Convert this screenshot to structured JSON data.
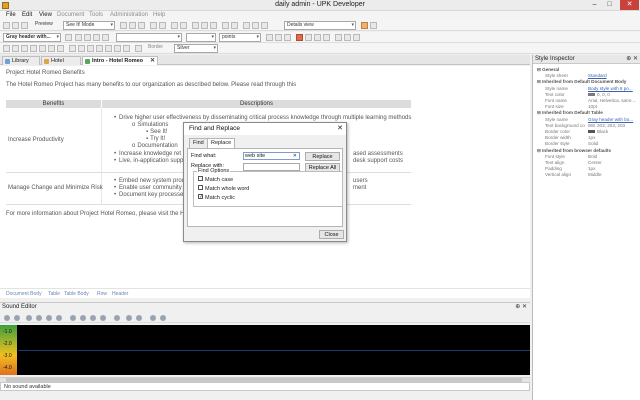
{
  "window": {
    "title": "daily admin - UPK Developer",
    "minimize": "–",
    "maximize": "□",
    "close": "✕"
  },
  "menu": [
    {
      "label": "File",
      "enabled": true
    },
    {
      "label": "Edit",
      "enabled": true
    },
    {
      "label": "View",
      "enabled": true
    },
    {
      "label": "Document",
      "enabled": false
    },
    {
      "label": "Tools",
      "enabled": false
    },
    {
      "label": "Administration",
      "enabled": false
    },
    {
      "label": "Help",
      "enabled": false
    }
  ],
  "toolbar1": {
    "preview_label": "Preview",
    "mode_value": "See It! Mode",
    "view_value": "Details view"
  },
  "toolbar2": {
    "style_value": "Gray header with...",
    "size_value": "points"
  },
  "toolbar3": {
    "fill_label": "Border",
    "fill_value": "Silver"
  },
  "tabs": [
    {
      "label": "Library",
      "active": false,
      "icon_color": "#6fa0d8"
    },
    {
      "label": "Hotel Romeo",
      "active": false,
      "icon_color": "#d9a845"
    },
    {
      "label": "Intro - Hotel Romeo",
      "active": true,
      "icon_color": "#5aa65a"
    }
  ],
  "doc": {
    "title": "Project Hotel Romeo Benefits",
    "intro": "The Hotel Romeo Project has many benefits to our organization as described below. Please read through this",
    "table_headers": [
      "Benefits",
      "Descriptions"
    ],
    "row1_label": "Increase Productivity",
    "row1_items": [
      "Drive higher user effectiveness by disseminating critical process knowledge through multiple learning methods",
      "Simulations",
      "See It!",
      "Try It!",
      "Documentation",
      "Increase knowledge ret",
      "ased assessments",
      "Live, in-application supp",
      "desk support costs"
    ],
    "row2_label": "Manage Change and Minimize Risk",
    "row2_items": [
      "Embed new system prod",
      "users",
      "Enable user community t",
      "ment",
      "Document key processes"
    ],
    "footer": "For more information about Project Hotel Romeo, please visit the H"
  },
  "breadcrumb": [
    "Document Body",
    "Table",
    "Table Body",
    "Row",
    "Header"
  ],
  "sound_editor": {
    "title": "Sound Editor",
    "pin_icons": "⊕ ✕",
    "meter_labels": [
      "-1.0",
      "-2.0",
      "-3.0",
      "-4.0"
    ],
    "status": "No sound available"
  },
  "inspector": {
    "title": "Style Inspector",
    "pin_icons": "⊕ ✕",
    "rows": [
      {
        "type": "group",
        "label": "⊟ General"
      },
      {
        "type": "prop",
        "key": "Style sheet",
        "value": "Standard",
        "link": true
      },
      {
        "type": "group",
        "label": "⊟ Inherited from Default Document Body"
      },
      {
        "type": "prop",
        "key": "Style name",
        "value": "Body style with 8 po...",
        "link": true
      },
      {
        "type": "prop",
        "key": "Text color",
        "value": "0, 0, 0",
        "swatch": "#7a7a7a"
      },
      {
        "type": "prop",
        "key": "Font name",
        "value": "Arial, Helvetica, sans-..."
      },
      {
        "type": "prop",
        "key": "Font size",
        "value": "10pt"
      },
      {
        "type": "group",
        "label": "⊟ Inherited from Default Table"
      },
      {
        "type": "prop",
        "key": "Style name",
        "value": "Gray header with bo...",
        "link": true
      },
      {
        "type": "prop",
        "key": "Text background co",
        "value": "203, 203, 203",
        "swatch": "#cbcbcb"
      },
      {
        "type": "prop",
        "key": "Border color",
        "value": "Black",
        "swatch": "#555555"
      },
      {
        "type": "prop",
        "key": "Border width",
        "value": "1px"
      },
      {
        "type": "prop",
        "key": "Border style",
        "value": "Solid"
      },
      {
        "type": "group",
        "label": "⊟ Inherited from browser defaults"
      },
      {
        "type": "prop",
        "key": "Font style",
        "value": "Bold"
      },
      {
        "type": "prop",
        "key": "Text align",
        "value": "Center"
      },
      {
        "type": "prop",
        "key": "Padding",
        "value": "1px"
      },
      {
        "type": "prop",
        "key": "Vertical align",
        "value": "Middle"
      }
    ]
  },
  "dialog": {
    "title": "Find and Replace",
    "tabs": [
      "Find",
      "Replace"
    ],
    "find_label": "Find what:",
    "find_value": "web site",
    "replace_label": "Replace with:",
    "replace_value": "",
    "replace_button": "Replace",
    "replace_all_button": "Replace All",
    "options_legend": "Find Options",
    "options": [
      {
        "label": "Match case",
        "checked": false
      },
      {
        "label": "Match whole word",
        "checked": false
      },
      {
        "label": "Match cyclic",
        "checked": true
      }
    ],
    "close_button": "Close"
  }
}
